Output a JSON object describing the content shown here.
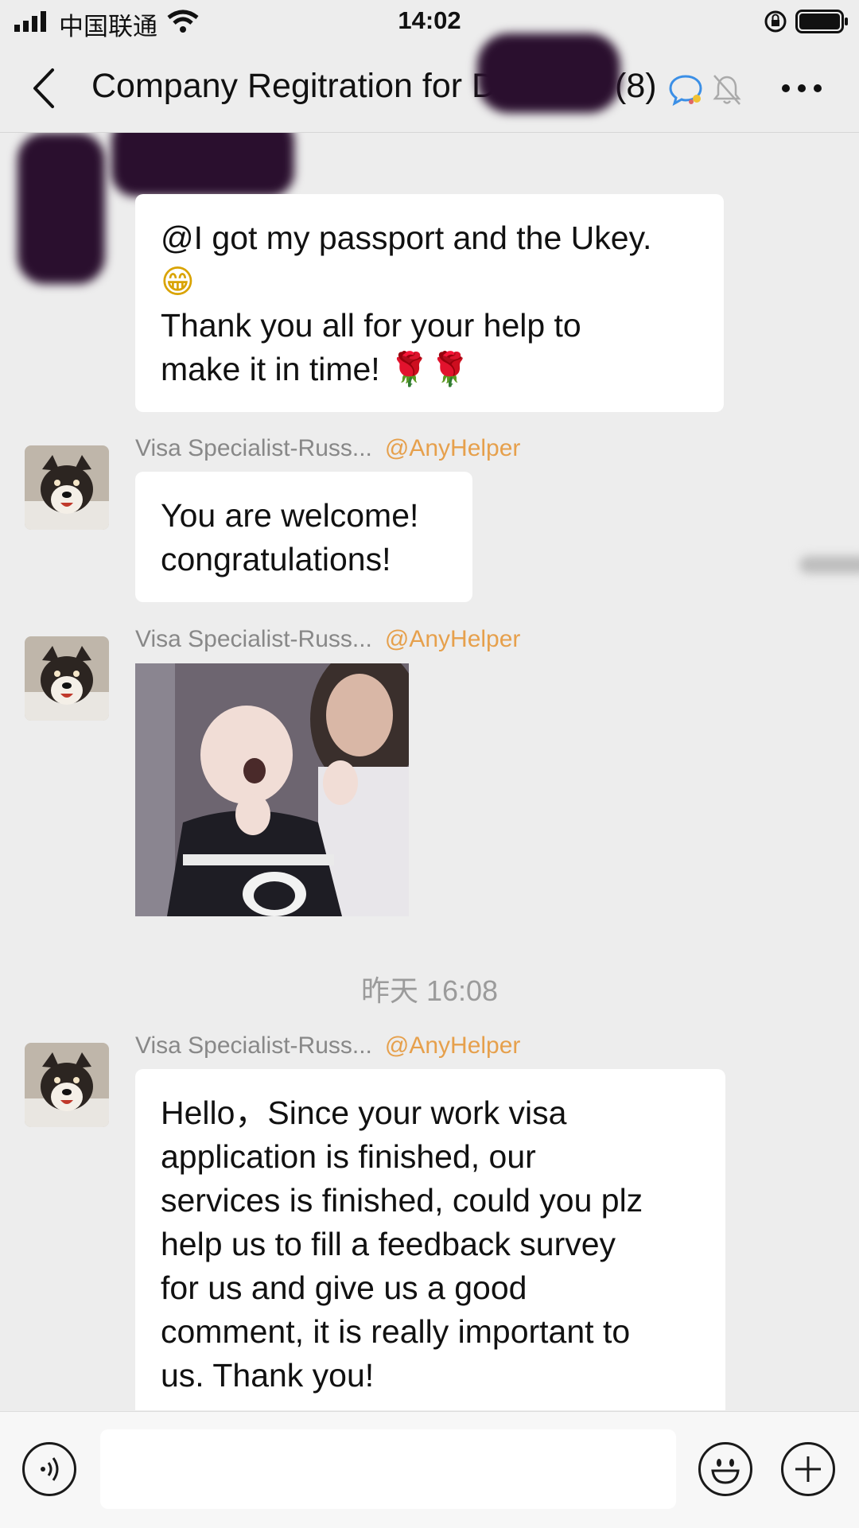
{
  "status_bar": {
    "carrier": "中国联通",
    "time": "14:02"
  },
  "header": {
    "title": "Company Regitration for D",
    "member_count": "(8)"
  },
  "messages": [
    {
      "lines": [
        "@I got my passport and the Ukey.",
        "😁",
        "Thank you all for your help to",
        "make it in time!  🌹🌹"
      ]
    },
    {
      "sender": "Visa Specialist-Russ...",
      "mention": "@AnyHelper",
      "lines": [
        "You are welcome!",
        "congratulations!"
      ]
    },
    {
      "sender": "Visa Specialist-Russ...",
      "mention": "@AnyHelper"
    },
    {
      "sender": "Visa Specialist-Russ...",
      "mention": "@AnyHelper",
      "lines": [
        "Hello，Since your work visa",
        "application is finished, our",
        "services is finished, could you plz",
        "help us to fill a feedback survey",
        "for us and give us a good",
        "comment, it is really important to",
        "us. Thank you!"
      ]
    }
  ],
  "timestamp": "昨天 16:08",
  "input": {
    "placeholder": ""
  },
  "icons": [
    "signal-icon",
    "wifi-icon",
    "rotation-lock-icon",
    "battery-icon",
    "back-chevron-icon",
    "chat-bubble-icon",
    "mute-bell-icon",
    "more-icon",
    "voice-icon",
    "emoji-icon",
    "add-icon"
  ],
  "colors": {
    "background": "#ededed",
    "bubble": "#ffffff",
    "mention": "#e6a04c",
    "sender": "#888888",
    "icon_blue": "#3b8fe6"
  }
}
